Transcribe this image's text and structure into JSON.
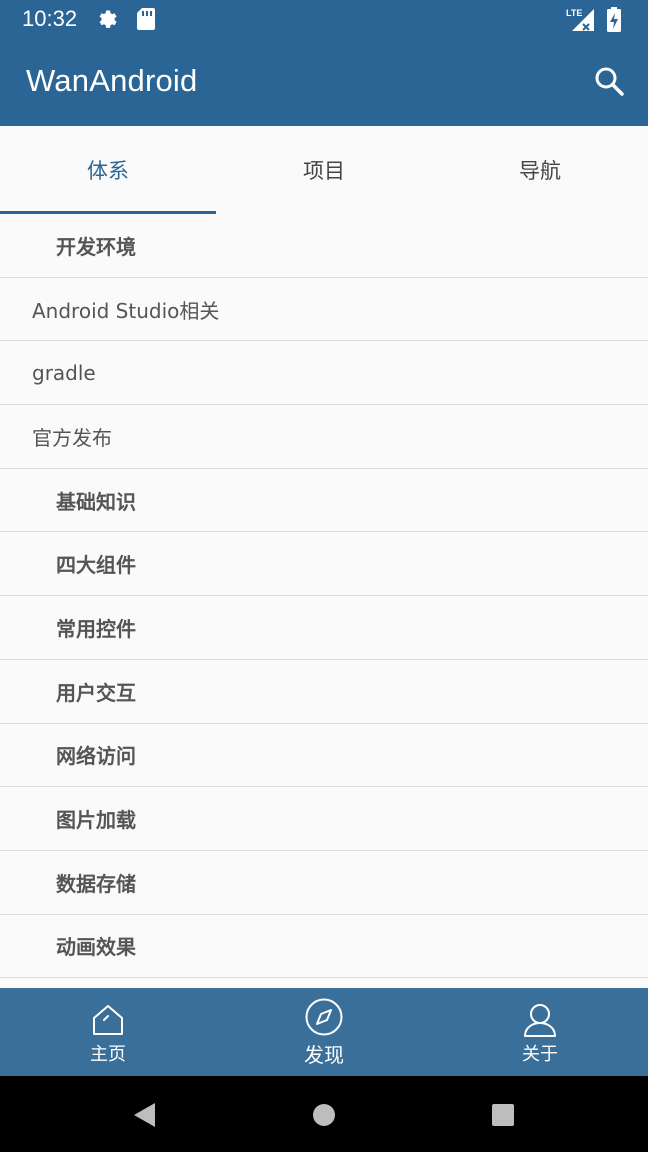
{
  "status_bar": {
    "time": "10:32",
    "icons": [
      "settings-icon",
      "sd-card-icon",
      "lte-signal-icon",
      "battery-charging-icon"
    ]
  },
  "app_bar": {
    "title": "WanAndroid",
    "search_icon": "search-icon"
  },
  "tabs": [
    {
      "label": "体系",
      "active": true
    },
    {
      "label": "项目",
      "active": false
    },
    {
      "label": "导航",
      "active": false
    }
  ],
  "list": {
    "items": [
      {
        "label": "开发环境",
        "level": "child"
      },
      {
        "label": "Android Studio相关",
        "level": "parent"
      },
      {
        "label": "gradle",
        "level": "parent"
      },
      {
        "label": "官方发布",
        "level": "parent"
      },
      {
        "label": "基础知识",
        "level": "child"
      },
      {
        "label": "四大组件",
        "level": "child"
      },
      {
        "label": "常用控件",
        "level": "child"
      },
      {
        "label": "用户交互",
        "level": "child"
      },
      {
        "label": "网络访问",
        "level": "child"
      },
      {
        "label": "图片加载",
        "level": "child"
      },
      {
        "label": "数据存储",
        "level": "child"
      },
      {
        "label": "动画效果",
        "level": "child"
      },
      {
        "label": "",
        "level": "child"
      }
    ]
  },
  "bottom_nav": [
    {
      "label": "主页",
      "icon": "home-icon",
      "active": false
    },
    {
      "label": "发现",
      "icon": "compass-icon",
      "active": true
    },
    {
      "label": "关于",
      "icon": "person-icon",
      "active": false
    }
  ],
  "colors": {
    "primary": "#2a6595",
    "bottom_nav": "#3a6f99",
    "background": "#fafafa",
    "divider": "#dcdcdc"
  }
}
